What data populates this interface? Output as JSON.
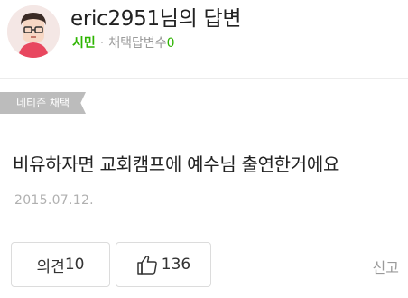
{
  "header": {
    "title": "eric2951님의 답변",
    "rank": "시민",
    "separator": "·",
    "adopted_label": "채택답변수",
    "adopted_count": "0"
  },
  "badge": {
    "label": "네티즌 채택"
  },
  "answer": {
    "text": "비유하자면 교회캠프에 예수님 출연한거에요",
    "date": "2015.07.12."
  },
  "actions": {
    "comment_label": "의견",
    "comment_count": "10",
    "like_count": "136",
    "report_label": "신고"
  },
  "colors": {
    "accent_green": "#2db400",
    "badge_gray": "#bcbcbc",
    "avatar_pink": "#e8475f"
  },
  "icons": {
    "avatar": "avatar-character-icon",
    "like": "thumbs-up-icon"
  }
}
